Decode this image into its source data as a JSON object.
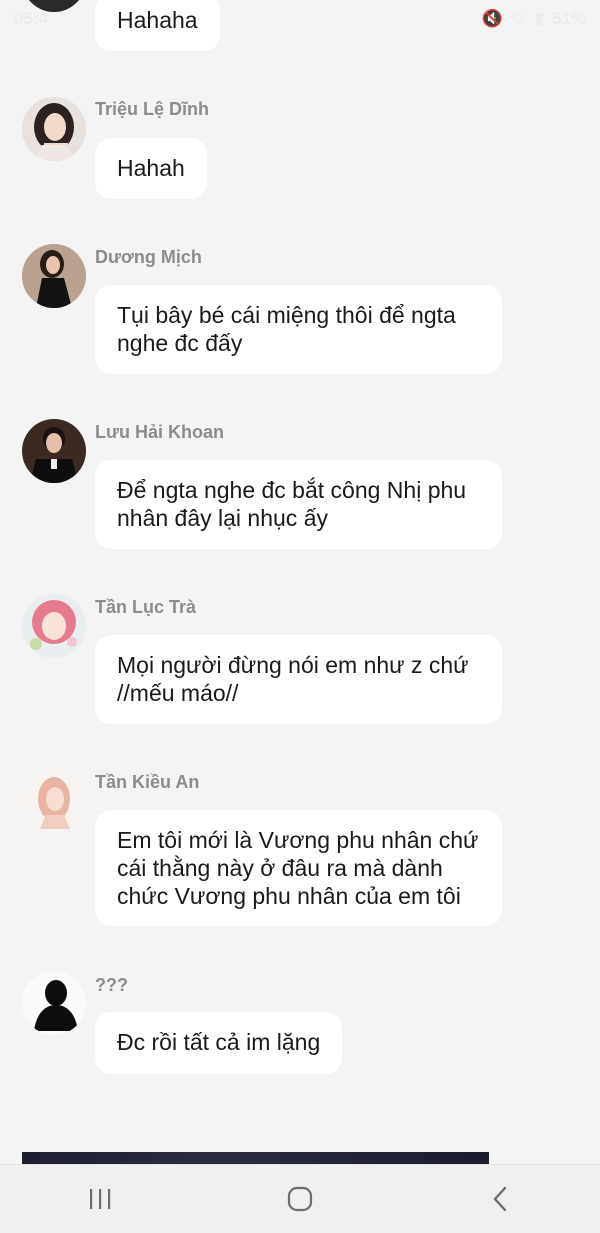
{
  "status_bar": {
    "time": "05:4",
    "battery": "51%"
  },
  "messages": [
    {
      "sender": "",
      "text": "Hahaha",
      "avatar": "avatar-partial"
    },
    {
      "sender": "Triệu Lệ Dĩnh",
      "text": "Hahah",
      "avatar": "woman-portrait"
    },
    {
      "sender": "Dương Mịch",
      "text": "Tụi bây bé cái miệng thôi để ngta nghe đc đấy",
      "avatar": "woman-black-dress"
    },
    {
      "sender": "Lưu Hải Khoan",
      "text": "Để ngta nghe đc bắt công Nhị phu nhân đây lại nhục ấy",
      "avatar": "man-suit"
    },
    {
      "sender": "Tần Lục Trà",
      "text": "Mọi người đừng nói em như z chứ //mếu máo//",
      "avatar": "anime-girl-pink"
    },
    {
      "sender": "Tần Kiều An",
      "text": "Em tôi mới là Vương phu nhân chứ cái thằng này ở đâu ra mà dành chức Vương phu nhân của em tôi",
      "avatar": "anime-girl-sketch"
    },
    {
      "sender": "???",
      "text": "Đc rồi tất cả im lặng",
      "avatar": "silhouette"
    }
  ],
  "nav": {
    "recent_icon": "recent-apps-icon",
    "home_icon": "home-icon",
    "back_icon": "back-icon"
  }
}
